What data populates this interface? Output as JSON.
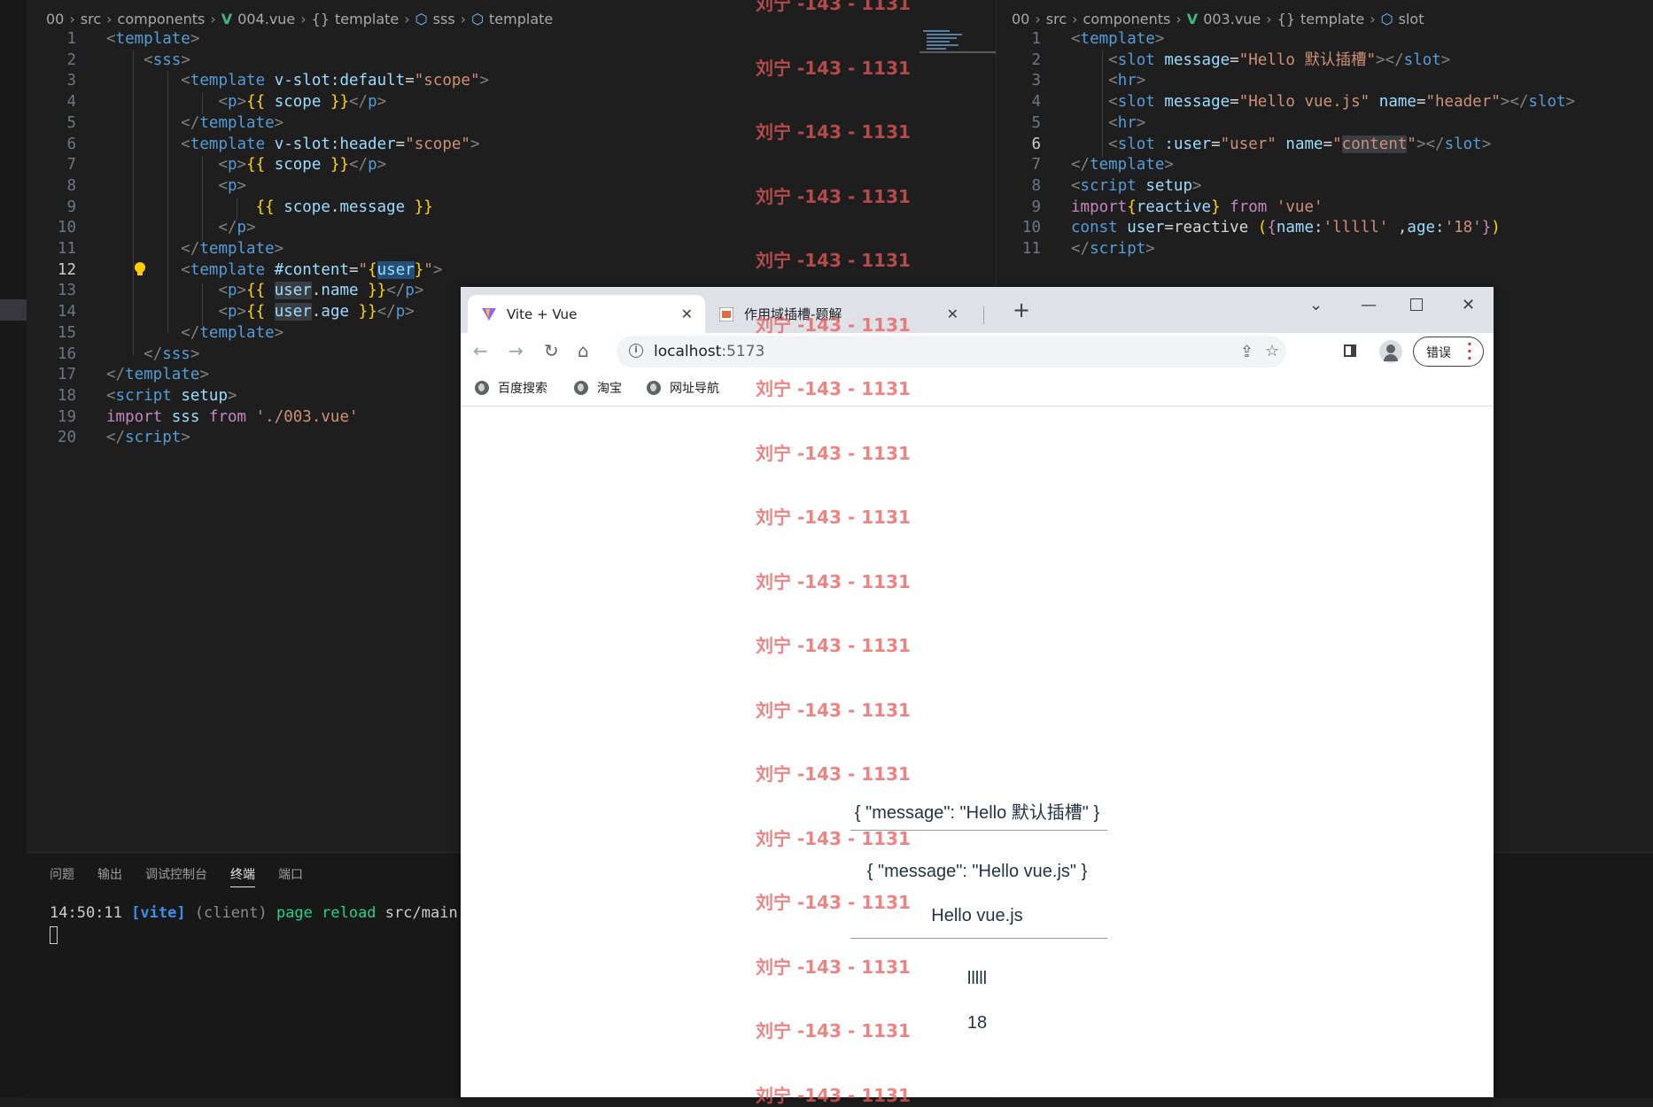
{
  "left_editor": {
    "breadcrumb": [
      "00",
      "src",
      "components",
      "004.vue",
      "template",
      "sss",
      "template"
    ],
    "lines": [
      {
        "n": "1",
        "tokens": [
          {
            "c": "tag",
            "t": "<"
          },
          {
            "c": "tn",
            "t": "template"
          },
          {
            "c": "tag",
            "t": ">"
          }
        ]
      },
      {
        "n": "2",
        "tokens": [
          {
            "c": "pl",
            "t": "    "
          },
          {
            "c": "tag",
            "t": "<"
          },
          {
            "c": "tn",
            "t": "sss"
          },
          {
            "c": "tag",
            "t": ">"
          }
        ]
      },
      {
        "n": "3",
        "tokens": [
          {
            "c": "pl",
            "t": "        "
          },
          {
            "c": "tag",
            "t": "<"
          },
          {
            "c": "tn",
            "t": "template"
          },
          {
            "c": "pl",
            "t": " "
          },
          {
            "c": "an",
            "t": "v-slot:default"
          },
          {
            "c": "pl",
            "t": "="
          },
          {
            "c": "av",
            "t": "\"scope\""
          },
          {
            "c": "tag",
            "t": ">"
          }
        ]
      },
      {
        "n": "4",
        "tokens": [
          {
            "c": "pl",
            "t": "            "
          },
          {
            "c": "tag",
            "t": "<"
          },
          {
            "c": "tn",
            "t": "p"
          },
          {
            "c": "tag",
            "t": ">"
          },
          {
            "c": "br",
            "t": "{{"
          },
          {
            "c": "pl",
            "t": " "
          },
          {
            "c": "vr",
            "t": "scope"
          },
          {
            "c": "pl",
            "t": " "
          },
          {
            "c": "br",
            "t": "}}"
          },
          {
            "c": "tag",
            "t": "</"
          },
          {
            "c": "tn",
            "t": "p"
          },
          {
            "c": "tag",
            "t": ">"
          }
        ]
      },
      {
        "n": "5",
        "tokens": [
          {
            "c": "pl",
            "t": "        "
          },
          {
            "c": "tag",
            "t": "</"
          },
          {
            "c": "tn",
            "t": "template"
          },
          {
            "c": "tag",
            "t": ">"
          }
        ]
      },
      {
        "n": "6",
        "tokens": [
          {
            "c": "pl",
            "t": "        "
          },
          {
            "c": "tag",
            "t": "<"
          },
          {
            "c": "tn",
            "t": "template"
          },
          {
            "c": "pl",
            "t": " "
          },
          {
            "c": "an",
            "t": "v-slot:header"
          },
          {
            "c": "pl",
            "t": "="
          },
          {
            "c": "av",
            "t": "\"scope\""
          },
          {
            "c": "tag",
            "t": ">"
          }
        ]
      },
      {
        "n": "7",
        "tokens": [
          {
            "c": "pl",
            "t": "            "
          },
          {
            "c": "tag",
            "t": "<"
          },
          {
            "c": "tn",
            "t": "p"
          },
          {
            "c": "tag",
            "t": ">"
          },
          {
            "c": "br",
            "t": "{{"
          },
          {
            "c": "pl",
            "t": " "
          },
          {
            "c": "vr",
            "t": "scope"
          },
          {
            "c": "pl",
            "t": " "
          },
          {
            "c": "br",
            "t": "}}"
          },
          {
            "c": "tag",
            "t": "</"
          },
          {
            "c": "tn",
            "t": "p"
          },
          {
            "c": "tag",
            "t": ">"
          }
        ]
      },
      {
        "n": "8",
        "tokens": [
          {
            "c": "pl",
            "t": "            "
          },
          {
            "c": "tag",
            "t": "<"
          },
          {
            "c": "tn",
            "t": "p"
          },
          {
            "c": "tag",
            "t": ">"
          }
        ]
      },
      {
        "n": "9",
        "tokens": [
          {
            "c": "pl",
            "t": "                "
          },
          {
            "c": "br",
            "t": "{{"
          },
          {
            "c": "pl",
            "t": " "
          },
          {
            "c": "vr",
            "t": "scope"
          },
          {
            "c": "pl",
            "t": "."
          },
          {
            "c": "vr",
            "t": "message"
          },
          {
            "c": "pl",
            "t": " "
          },
          {
            "c": "br",
            "t": "}}"
          }
        ]
      },
      {
        "n": "10",
        "tokens": [
          {
            "c": "pl",
            "t": "            "
          },
          {
            "c": "tag",
            "t": "</"
          },
          {
            "c": "tn",
            "t": "p"
          },
          {
            "c": "tag",
            "t": ">"
          }
        ]
      },
      {
        "n": "11",
        "tokens": [
          {
            "c": "pl",
            "t": "        "
          },
          {
            "c": "tag",
            "t": "</"
          },
          {
            "c": "tn",
            "t": "template"
          },
          {
            "c": "tag",
            "t": ">"
          }
        ]
      },
      {
        "n": "12",
        "cur": true,
        "tokens": [
          {
            "c": "pl",
            "t": "        "
          },
          {
            "c": "tag",
            "t": "<"
          },
          {
            "c": "tn",
            "t": "template"
          },
          {
            "c": "pl",
            "t": " "
          },
          {
            "c": "an",
            "t": "#content"
          },
          {
            "c": "pl",
            "t": "="
          },
          {
            "c": "av",
            "t": "\""
          },
          {
            "c": "br",
            "t": "{"
          },
          {
            "c": "vr hl",
            "t": "user"
          },
          {
            "c": "br",
            "t": "}"
          },
          {
            "c": "av",
            "t": "\""
          },
          {
            "c": "tag",
            "t": ">"
          }
        ]
      },
      {
        "n": "13",
        "tokens": [
          {
            "c": "pl",
            "t": "            "
          },
          {
            "c": "tag",
            "t": "<"
          },
          {
            "c": "tn",
            "t": "p"
          },
          {
            "c": "tag",
            "t": ">"
          },
          {
            "c": "br",
            "t": "{{"
          },
          {
            "c": "pl",
            "t": " "
          },
          {
            "c": "vr hl2",
            "t": "user"
          },
          {
            "c": "pl",
            "t": "."
          },
          {
            "c": "vr",
            "t": "name"
          },
          {
            "c": "pl",
            "t": " "
          },
          {
            "c": "br",
            "t": "}}"
          },
          {
            "c": "tag",
            "t": "</"
          },
          {
            "c": "tn",
            "t": "p"
          },
          {
            "c": "tag",
            "t": ">"
          }
        ]
      },
      {
        "n": "14",
        "tokens": [
          {
            "c": "pl",
            "t": "            "
          },
          {
            "c": "tag",
            "t": "<"
          },
          {
            "c": "tn",
            "t": "p"
          },
          {
            "c": "tag",
            "t": ">"
          },
          {
            "c": "br",
            "t": "{{"
          },
          {
            "c": "pl",
            "t": " "
          },
          {
            "c": "vr hl2",
            "t": "user"
          },
          {
            "c": "pl",
            "t": "."
          },
          {
            "c": "vr",
            "t": "age"
          },
          {
            "c": "pl",
            "t": " "
          },
          {
            "c": "br",
            "t": "}}"
          },
          {
            "c": "tag",
            "t": "</"
          },
          {
            "c": "tn",
            "t": "p"
          },
          {
            "c": "tag",
            "t": ">"
          }
        ]
      },
      {
        "n": "15",
        "tokens": [
          {
            "c": "pl",
            "t": "        "
          },
          {
            "c": "tag",
            "t": "</"
          },
          {
            "c": "tn",
            "t": "template"
          },
          {
            "c": "tag",
            "t": ">"
          }
        ]
      },
      {
        "n": "16",
        "tokens": [
          {
            "c": "pl",
            "t": "    "
          },
          {
            "c": "tag",
            "t": "</"
          },
          {
            "c": "tn",
            "t": "sss"
          },
          {
            "c": "tag",
            "t": ">"
          }
        ]
      },
      {
        "n": "17",
        "tokens": [
          {
            "c": "tag",
            "t": "</"
          },
          {
            "c": "tn",
            "t": "template"
          },
          {
            "c": "tag",
            "t": ">"
          }
        ]
      },
      {
        "n": "18",
        "tokens": [
          {
            "c": "tag",
            "t": "<"
          },
          {
            "c": "tn",
            "t": "script"
          },
          {
            "c": "pl",
            "t": " "
          },
          {
            "c": "an",
            "t": "setup"
          },
          {
            "c": "tag",
            "t": ">"
          }
        ]
      },
      {
        "n": "19",
        "tokens": [
          {
            "c": "kw",
            "t": "import"
          },
          {
            "c": "pl",
            "t": " "
          },
          {
            "c": "vr",
            "t": "sss"
          },
          {
            "c": "pl",
            "t": " "
          },
          {
            "c": "kw",
            "t": "from"
          },
          {
            "c": "pl",
            "t": " "
          },
          {
            "c": "av",
            "t": "'./003.vue'"
          }
        ]
      },
      {
        "n": "20",
        "tokens": [
          {
            "c": "tag",
            "t": "</"
          },
          {
            "c": "tn",
            "t": "script"
          },
          {
            "c": "tag",
            "t": ">"
          }
        ]
      }
    ]
  },
  "right_editor": {
    "breadcrumb": [
      "00",
      "src",
      "components",
      "003.vue",
      "template",
      "slot"
    ],
    "lines": [
      {
        "n": "1",
        "tokens": [
          {
            "c": "tag",
            "t": "<"
          },
          {
            "c": "tn",
            "t": "template"
          },
          {
            "c": "tag",
            "t": ">"
          }
        ]
      },
      {
        "n": "2",
        "tokens": [
          {
            "c": "pl",
            "t": "    "
          },
          {
            "c": "tag",
            "t": "<"
          },
          {
            "c": "tn",
            "t": "slot"
          },
          {
            "c": "pl",
            "t": " "
          },
          {
            "c": "an",
            "t": "message"
          },
          {
            "c": "pl",
            "t": "="
          },
          {
            "c": "av",
            "t": "\"Hello 默认插槽\""
          },
          {
            "c": "tag",
            "t": "></"
          },
          {
            "c": "tn",
            "t": "slot"
          },
          {
            "c": "tag",
            "t": ">"
          }
        ]
      },
      {
        "n": "3",
        "tokens": [
          {
            "c": "pl",
            "t": "    "
          },
          {
            "c": "tag",
            "t": "<"
          },
          {
            "c": "tn",
            "t": "hr"
          },
          {
            "c": "tag",
            "t": ">"
          }
        ]
      },
      {
        "n": "4",
        "tokens": [
          {
            "c": "pl",
            "t": "    "
          },
          {
            "c": "tag",
            "t": "<"
          },
          {
            "c": "tn",
            "t": "slot"
          },
          {
            "c": "pl",
            "t": " "
          },
          {
            "c": "an",
            "t": "message"
          },
          {
            "c": "pl",
            "t": "="
          },
          {
            "c": "av",
            "t": "\"Hello vue.js\""
          },
          {
            "c": "pl",
            "t": " "
          },
          {
            "c": "an",
            "t": "name"
          },
          {
            "c": "pl",
            "t": "="
          },
          {
            "c": "av",
            "t": "\"header\""
          },
          {
            "c": "tag",
            "t": "></"
          },
          {
            "c": "tn",
            "t": "slot"
          },
          {
            "c": "tag",
            "t": ">"
          }
        ]
      },
      {
        "n": "5",
        "tokens": [
          {
            "c": "pl",
            "t": "    "
          },
          {
            "c": "tag",
            "t": "<"
          },
          {
            "c": "tn",
            "t": "hr"
          },
          {
            "c": "tag",
            "t": ">"
          }
        ]
      },
      {
        "n": "6",
        "cur": true,
        "tokens": [
          {
            "c": "pl",
            "t": "    "
          },
          {
            "c": "tag",
            "t": "<"
          },
          {
            "c": "tn",
            "t": "slot"
          },
          {
            "c": "pl",
            "t": " "
          },
          {
            "c": "an",
            "t": ":user"
          },
          {
            "c": "pl",
            "t": "="
          },
          {
            "c": "av",
            "t": "\"user\""
          },
          {
            "c": "pl",
            "t": " "
          },
          {
            "c": "an",
            "t": "name"
          },
          {
            "c": "pl",
            "t": "="
          },
          {
            "c": "av",
            "t": "\""
          },
          {
            "c": "av hl2",
            "t": "content"
          },
          {
            "c": "av",
            "t": "\""
          },
          {
            "c": "tag",
            "t": "></"
          },
          {
            "c": "tn",
            "t": "slot"
          },
          {
            "c": "tag",
            "t": ">"
          }
        ]
      },
      {
        "n": "7",
        "tokens": [
          {
            "c": "tag",
            "t": "</"
          },
          {
            "c": "tn",
            "t": "template"
          },
          {
            "c": "tag",
            "t": ">"
          }
        ]
      },
      {
        "n": "8",
        "tokens": [
          {
            "c": "tag",
            "t": "<"
          },
          {
            "c": "tn",
            "t": "script"
          },
          {
            "c": "pl",
            "t": " "
          },
          {
            "c": "an",
            "t": "setup"
          },
          {
            "c": "tag",
            "t": ">"
          }
        ]
      },
      {
        "n": "9",
        "tokens": [
          {
            "c": "kw",
            "t": "import"
          },
          {
            "c": "br",
            "t": "{"
          },
          {
            "c": "vr",
            "t": "reactive"
          },
          {
            "c": "br",
            "t": "}"
          },
          {
            "c": "pl",
            "t": " "
          },
          {
            "c": "kw",
            "t": "from"
          },
          {
            "c": "pl",
            "t": " "
          },
          {
            "c": "av",
            "t": "'vue'"
          }
        ]
      },
      {
        "n": "10",
        "tokens": [
          {
            "c": "tn",
            "t": "const"
          },
          {
            "c": "pl",
            "t": " "
          },
          {
            "c": "vr",
            "t": "user"
          },
          {
            "c": "pl",
            "t": "="
          },
          {
            "c": "pl",
            "t": "reactive "
          },
          {
            "c": "br",
            "t": "("
          },
          {
            "c": "kw",
            "t": "{"
          },
          {
            "c": "vr",
            "t": "name"
          },
          {
            "c": "pl",
            "t": ":"
          },
          {
            "c": "av",
            "t": "'lllll'"
          },
          {
            "c": "pl",
            "t": " ,"
          },
          {
            "c": "vr",
            "t": "age"
          },
          {
            "c": "pl",
            "t": ":"
          },
          {
            "c": "av",
            "t": "'18'"
          },
          {
            "c": "kw",
            "t": "}"
          },
          {
            "c": "br",
            "t": ")"
          }
        ]
      },
      {
        "n": "11",
        "tokens": [
          {
            "c": "tag",
            "t": "</"
          },
          {
            "c": "tn",
            "t": "script"
          },
          {
            "c": "tag",
            "t": ">"
          }
        ]
      }
    ]
  },
  "panel": {
    "tabs": [
      "问题",
      "输出",
      "调试控制台",
      "终端",
      "端口"
    ],
    "active_tab": "终端",
    "terminal": {
      "time": "14:50:11",
      "tag": "[vite]",
      "client": "(client)",
      "action": "page reload",
      "path": "src/main.js"
    }
  },
  "browser": {
    "tabs": [
      {
        "title": "Vite + Vue",
        "active": true
      },
      {
        "title": "作用域插槽-题解",
        "active": false
      }
    ],
    "new_tab": "+",
    "url_host": "localhost",
    "url_port": ":5173",
    "error_button": "错误",
    "bookmarks": [
      "百度搜索",
      "淘宝",
      "网址导航"
    ],
    "content": {
      "default_slot": "{ \"message\": \"Hello 默认插槽\" }",
      "header_slot": "{ \"message\": \"Hello vue.js\" }",
      "header_message": "Hello vue.js",
      "user_name": "lllll",
      "user_age": "18"
    }
  },
  "watermark": {
    "text": "刘宁 -143 - 1131",
    "count": 18
  },
  "colors": {
    "editor_bg": "#1e1e1e",
    "panel_bg": "#181818",
    "watermark": "#e85a5a",
    "vue_green": "#41b883"
  }
}
